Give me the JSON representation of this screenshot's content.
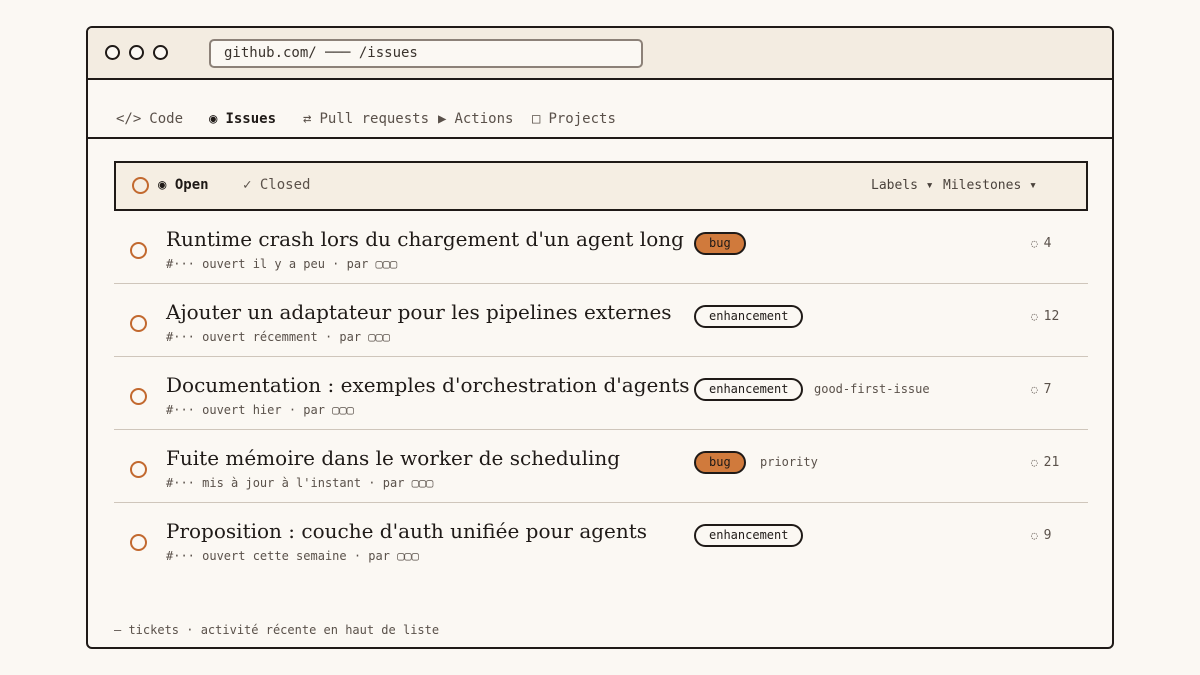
{
  "browser": {
    "url": "github.com/ ─── /issues"
  },
  "repo_tabs": [
    {
      "icon": "</>",
      "label": "Code"
    },
    {
      "icon": "◉",
      "label": "Issues"
    },
    {
      "icon": "⇄",
      "label": "Pull requests"
    },
    {
      "icon": "▶",
      "label": "Actions"
    },
    {
      "icon": "□",
      "label": "Projects"
    }
  ],
  "filters": {
    "open_icon": "◉",
    "open_label": "Open",
    "closed_icon": "✓",
    "closed_label": "Closed",
    "labels_dropdown": "Labels ▾",
    "milestones_dropdown": "Milestones ▾"
  },
  "issues": [
    {
      "title": "Runtime crash lors du chargement d'un agent long",
      "meta": "#··· ouvert il y a peu · par ▢▢▢",
      "label": "bug",
      "extra": "",
      "comments": "4"
    },
    {
      "title": "Ajouter un adaptateur pour les pipelines externes",
      "meta": "#··· ouvert récemment · par ▢▢▢",
      "label": "enhancement",
      "extra": "",
      "comments": "12"
    },
    {
      "title": "Documentation : exemples d'orchestration d'agents",
      "meta": "#··· ouvert hier · par ▢▢▢",
      "label": "enhancement",
      "extra": "good-first-issue",
      "comments": "7"
    },
    {
      "title": "Fuite mémoire dans le worker de scheduling",
      "meta": "#··· mis à jour à l'instant · par ▢▢▢",
      "label": "bug",
      "extra": "priority",
      "comments": "21"
    },
    {
      "title": "Proposition : couche d'auth unifiée pour agents",
      "meta": "#··· ouvert cette semaine · par ▢▢▢",
      "label": "enhancement",
      "extra": "",
      "comments": "9"
    }
  ],
  "comment_icon": "◌",
  "footer": "— tickets · activité récente en haut de liste",
  "colors": {
    "accent": "#c2692f",
    "bug_label": "#d07a3c",
    "background": "#fbf8f3",
    "chrome": "#f3ece1"
  }
}
